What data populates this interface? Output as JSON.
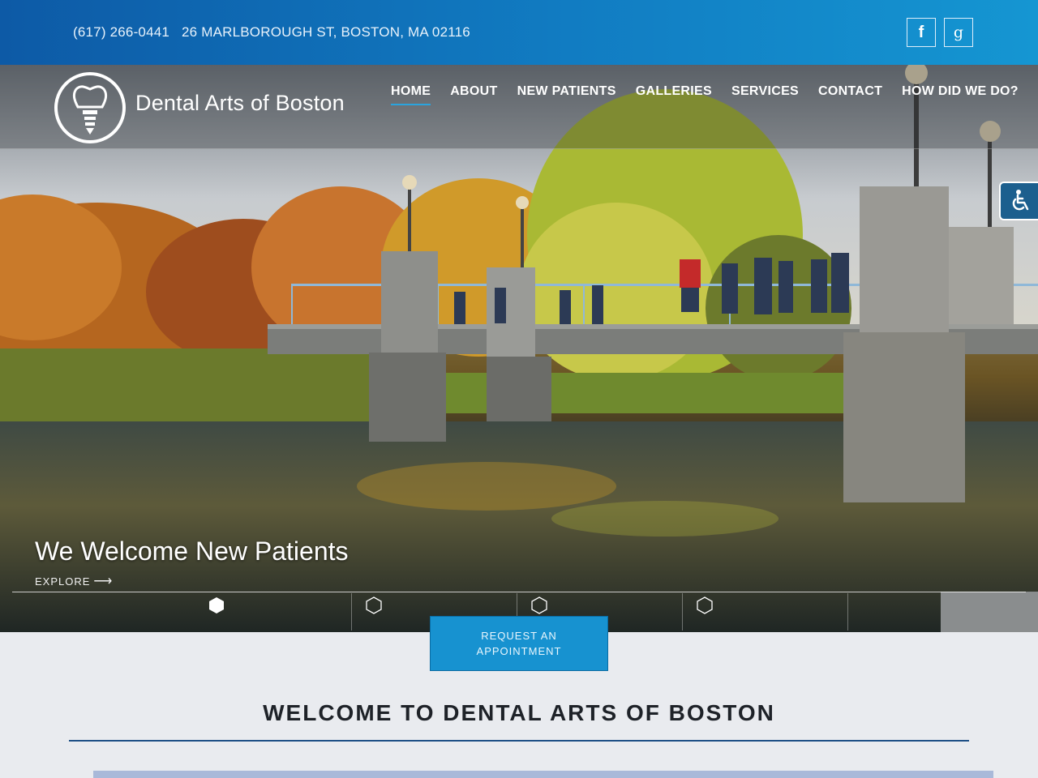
{
  "topbar": {
    "phone": "(617) 266-0441",
    "address": "26 MARLBOROUGH ST, BOSTON, MA 02116",
    "social": [
      {
        "icon": "facebook-icon",
        "glyph": "f"
      },
      {
        "icon": "google-plus-icon",
        "glyph": "g"
      }
    ]
  },
  "brand": {
    "name": "Dental Arts of Boston",
    "logo_icon": "tooth-implant-icon"
  },
  "nav": {
    "items": [
      {
        "label": "HOME",
        "active": true
      },
      {
        "label": "ABOUT",
        "active": false
      },
      {
        "label": "NEW PATIENTS",
        "active": false
      },
      {
        "label": "GALLERIES",
        "active": false
      },
      {
        "label": "SERVICES",
        "active": false
      },
      {
        "label": "CONTACT",
        "active": false
      },
      {
        "label": "HOW DID WE DO?",
        "active": false
      }
    ]
  },
  "accessibility": {
    "icon": "wheelchair-icon"
  },
  "hero": {
    "slide_title": "We Welcome New Patients",
    "explore_label": "EXPLORE",
    "explore_icon": "arrow-right-icon",
    "slides": [
      {
        "icon": "hexagon-icon",
        "active": true
      },
      {
        "icon": "hexagon-icon",
        "active": false
      },
      {
        "icon": "hexagon-icon",
        "active": false
      },
      {
        "icon": "hexagon-icon",
        "active": false
      }
    ]
  },
  "cta": {
    "label": "REQUEST AN APPOINTMENT"
  },
  "main": {
    "heading": "WELCOME TO DENTAL ARTS OF BOSTON"
  },
  "colors": {
    "topbar_start": "#0d5aa6",
    "topbar_end": "#1596d2",
    "accent": "#1792d0",
    "heading_rule": "#1d4f86",
    "page_bg": "#e9ebef"
  }
}
